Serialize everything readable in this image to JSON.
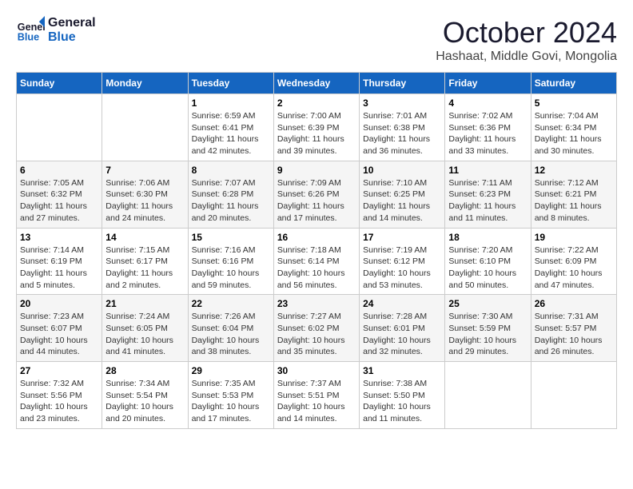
{
  "header": {
    "logo_line1": "General",
    "logo_line2": "Blue",
    "month": "October 2024",
    "location": "Hashaat, Middle Govi, Mongolia"
  },
  "weekdays": [
    "Sunday",
    "Monday",
    "Tuesday",
    "Wednesday",
    "Thursday",
    "Friday",
    "Saturday"
  ],
  "weeks": [
    [
      {
        "day": "",
        "sunrise": "",
        "sunset": "",
        "daylight": ""
      },
      {
        "day": "",
        "sunrise": "",
        "sunset": "",
        "daylight": ""
      },
      {
        "day": "1",
        "sunrise": "Sunrise: 6:59 AM",
        "sunset": "Sunset: 6:41 PM",
        "daylight": "Daylight: 11 hours and 42 minutes."
      },
      {
        "day": "2",
        "sunrise": "Sunrise: 7:00 AM",
        "sunset": "Sunset: 6:39 PM",
        "daylight": "Daylight: 11 hours and 39 minutes."
      },
      {
        "day": "3",
        "sunrise": "Sunrise: 7:01 AM",
        "sunset": "Sunset: 6:38 PM",
        "daylight": "Daylight: 11 hours and 36 minutes."
      },
      {
        "day": "4",
        "sunrise": "Sunrise: 7:02 AM",
        "sunset": "Sunset: 6:36 PM",
        "daylight": "Daylight: 11 hours and 33 minutes."
      },
      {
        "day": "5",
        "sunrise": "Sunrise: 7:04 AM",
        "sunset": "Sunset: 6:34 PM",
        "daylight": "Daylight: 11 hours and 30 minutes."
      }
    ],
    [
      {
        "day": "6",
        "sunrise": "Sunrise: 7:05 AM",
        "sunset": "Sunset: 6:32 PM",
        "daylight": "Daylight: 11 hours and 27 minutes."
      },
      {
        "day": "7",
        "sunrise": "Sunrise: 7:06 AM",
        "sunset": "Sunset: 6:30 PM",
        "daylight": "Daylight: 11 hours and 24 minutes."
      },
      {
        "day": "8",
        "sunrise": "Sunrise: 7:07 AM",
        "sunset": "Sunset: 6:28 PM",
        "daylight": "Daylight: 11 hours and 20 minutes."
      },
      {
        "day": "9",
        "sunrise": "Sunrise: 7:09 AM",
        "sunset": "Sunset: 6:26 PM",
        "daylight": "Daylight: 11 hours and 17 minutes."
      },
      {
        "day": "10",
        "sunrise": "Sunrise: 7:10 AM",
        "sunset": "Sunset: 6:25 PM",
        "daylight": "Daylight: 11 hours and 14 minutes."
      },
      {
        "day": "11",
        "sunrise": "Sunrise: 7:11 AM",
        "sunset": "Sunset: 6:23 PM",
        "daylight": "Daylight: 11 hours and 11 minutes."
      },
      {
        "day": "12",
        "sunrise": "Sunrise: 7:12 AM",
        "sunset": "Sunset: 6:21 PM",
        "daylight": "Daylight: 11 hours and 8 minutes."
      }
    ],
    [
      {
        "day": "13",
        "sunrise": "Sunrise: 7:14 AM",
        "sunset": "Sunset: 6:19 PM",
        "daylight": "Daylight: 11 hours and 5 minutes."
      },
      {
        "day": "14",
        "sunrise": "Sunrise: 7:15 AM",
        "sunset": "Sunset: 6:17 PM",
        "daylight": "Daylight: 11 hours and 2 minutes."
      },
      {
        "day": "15",
        "sunrise": "Sunrise: 7:16 AM",
        "sunset": "Sunset: 6:16 PM",
        "daylight": "Daylight: 10 hours and 59 minutes."
      },
      {
        "day": "16",
        "sunrise": "Sunrise: 7:18 AM",
        "sunset": "Sunset: 6:14 PM",
        "daylight": "Daylight: 10 hours and 56 minutes."
      },
      {
        "day": "17",
        "sunrise": "Sunrise: 7:19 AM",
        "sunset": "Sunset: 6:12 PM",
        "daylight": "Daylight: 10 hours and 53 minutes."
      },
      {
        "day": "18",
        "sunrise": "Sunrise: 7:20 AM",
        "sunset": "Sunset: 6:10 PM",
        "daylight": "Daylight: 10 hours and 50 minutes."
      },
      {
        "day": "19",
        "sunrise": "Sunrise: 7:22 AM",
        "sunset": "Sunset: 6:09 PM",
        "daylight": "Daylight: 10 hours and 47 minutes."
      }
    ],
    [
      {
        "day": "20",
        "sunrise": "Sunrise: 7:23 AM",
        "sunset": "Sunset: 6:07 PM",
        "daylight": "Daylight: 10 hours and 44 minutes."
      },
      {
        "day": "21",
        "sunrise": "Sunrise: 7:24 AM",
        "sunset": "Sunset: 6:05 PM",
        "daylight": "Daylight: 10 hours and 41 minutes."
      },
      {
        "day": "22",
        "sunrise": "Sunrise: 7:26 AM",
        "sunset": "Sunset: 6:04 PM",
        "daylight": "Daylight: 10 hours and 38 minutes."
      },
      {
        "day": "23",
        "sunrise": "Sunrise: 7:27 AM",
        "sunset": "Sunset: 6:02 PM",
        "daylight": "Daylight: 10 hours and 35 minutes."
      },
      {
        "day": "24",
        "sunrise": "Sunrise: 7:28 AM",
        "sunset": "Sunset: 6:01 PM",
        "daylight": "Daylight: 10 hours and 32 minutes."
      },
      {
        "day": "25",
        "sunrise": "Sunrise: 7:30 AM",
        "sunset": "Sunset: 5:59 PM",
        "daylight": "Daylight: 10 hours and 29 minutes."
      },
      {
        "day": "26",
        "sunrise": "Sunrise: 7:31 AM",
        "sunset": "Sunset: 5:57 PM",
        "daylight": "Daylight: 10 hours and 26 minutes."
      }
    ],
    [
      {
        "day": "27",
        "sunrise": "Sunrise: 7:32 AM",
        "sunset": "Sunset: 5:56 PM",
        "daylight": "Daylight: 10 hours and 23 minutes."
      },
      {
        "day": "28",
        "sunrise": "Sunrise: 7:34 AM",
        "sunset": "Sunset: 5:54 PM",
        "daylight": "Daylight: 10 hours and 20 minutes."
      },
      {
        "day": "29",
        "sunrise": "Sunrise: 7:35 AM",
        "sunset": "Sunset: 5:53 PM",
        "daylight": "Daylight: 10 hours and 17 minutes."
      },
      {
        "day": "30",
        "sunrise": "Sunrise: 7:37 AM",
        "sunset": "Sunset: 5:51 PM",
        "daylight": "Daylight: 10 hours and 14 minutes."
      },
      {
        "day": "31",
        "sunrise": "Sunrise: 7:38 AM",
        "sunset": "Sunset: 5:50 PM",
        "daylight": "Daylight: 10 hours and 11 minutes."
      },
      {
        "day": "",
        "sunrise": "",
        "sunset": "",
        "daylight": ""
      },
      {
        "day": "",
        "sunrise": "",
        "sunset": "",
        "daylight": ""
      }
    ]
  ]
}
